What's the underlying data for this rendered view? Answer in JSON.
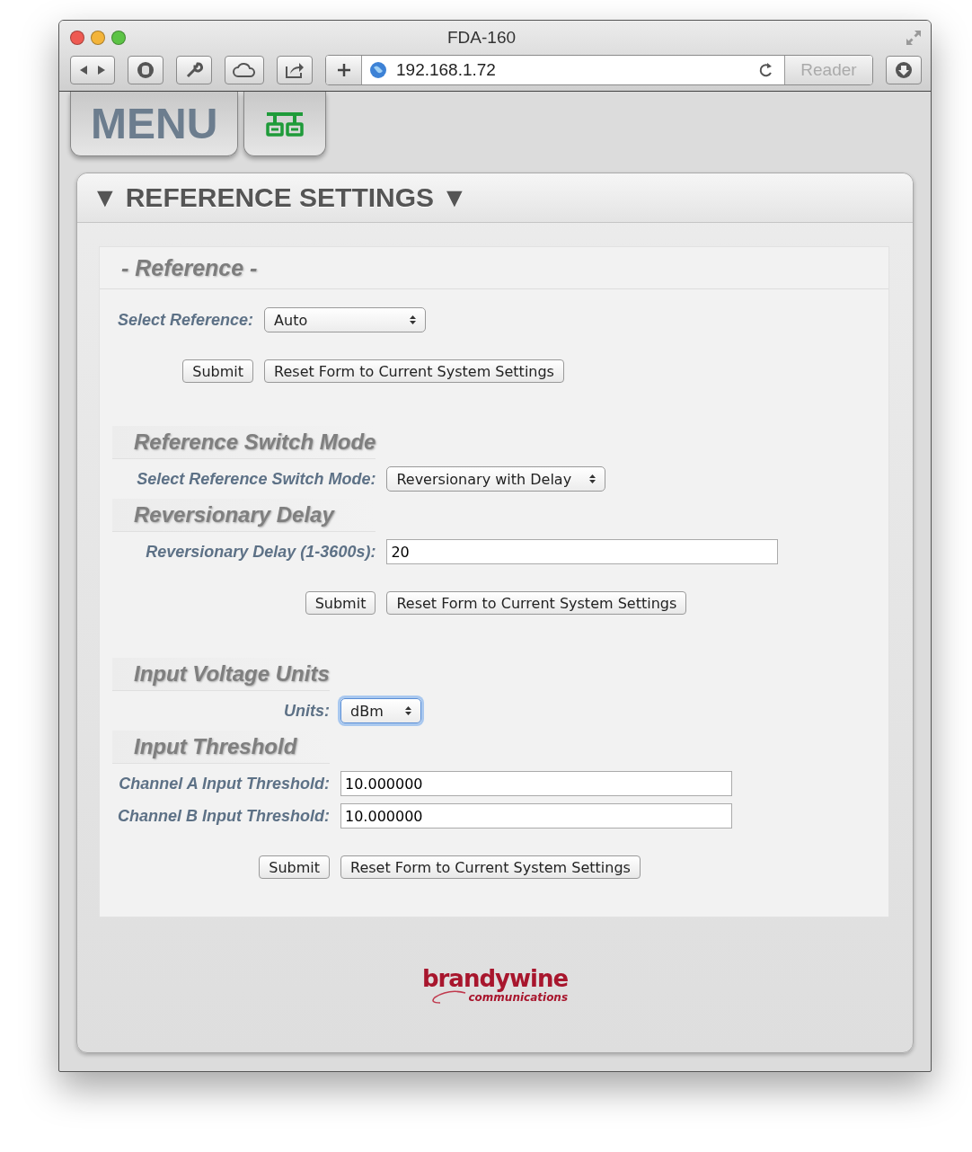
{
  "window": {
    "title": "FDA-160",
    "address": "192.168.1.72",
    "reader": "Reader"
  },
  "menu_tabs": [
    {
      "kind": "text",
      "label": "MENU"
    },
    {
      "kind": "network"
    }
  ],
  "panel": {
    "title": "REFERENCE SETTINGS",
    "arrow_left": "▼",
    "arrow_right": "▼",
    "box_header": "- Reference -",
    "groups": [
      {
        "items": [
          {
            "kind": "select",
            "label": "Select Reference:",
            "value": "Auto",
            "focused": false,
            "wide": true
          }
        ],
        "buttons": [
          "Submit",
          "Reset Form to Current System Settings"
        ]
      },
      {
        "items": [
          {
            "kind": "heading",
            "label": "Reference Switch Mode"
          },
          {
            "kind": "select",
            "label": "Select Reference Switch Mode:",
            "value": "Reversionary with Delay",
            "focused": false,
            "wide": true
          },
          {
            "kind": "heading",
            "label": "Reversionary Delay"
          },
          {
            "kind": "text",
            "label": "Reversionary Delay (1-3600s):",
            "value": "20"
          }
        ],
        "buttons": [
          "Submit",
          "Reset Form to Current System Settings"
        ]
      },
      {
        "items": [
          {
            "kind": "heading",
            "label": "Input Voltage Units"
          },
          {
            "kind": "select",
            "label": "Units:",
            "value": "dBm",
            "focused": true,
            "wide": false
          },
          {
            "kind": "heading",
            "label": "Input Threshold"
          },
          {
            "kind": "text",
            "label": "Channel A Input Threshold:",
            "value": "10.000000"
          },
          {
            "kind": "text",
            "label": "Channel B Input Threshold:",
            "value": "10.000000"
          }
        ],
        "buttons": [
          "Submit",
          "Reset Form to Current System Settings"
        ]
      }
    ]
  },
  "footer_logo": {
    "name": "brandywine",
    "tagline": "communications"
  }
}
